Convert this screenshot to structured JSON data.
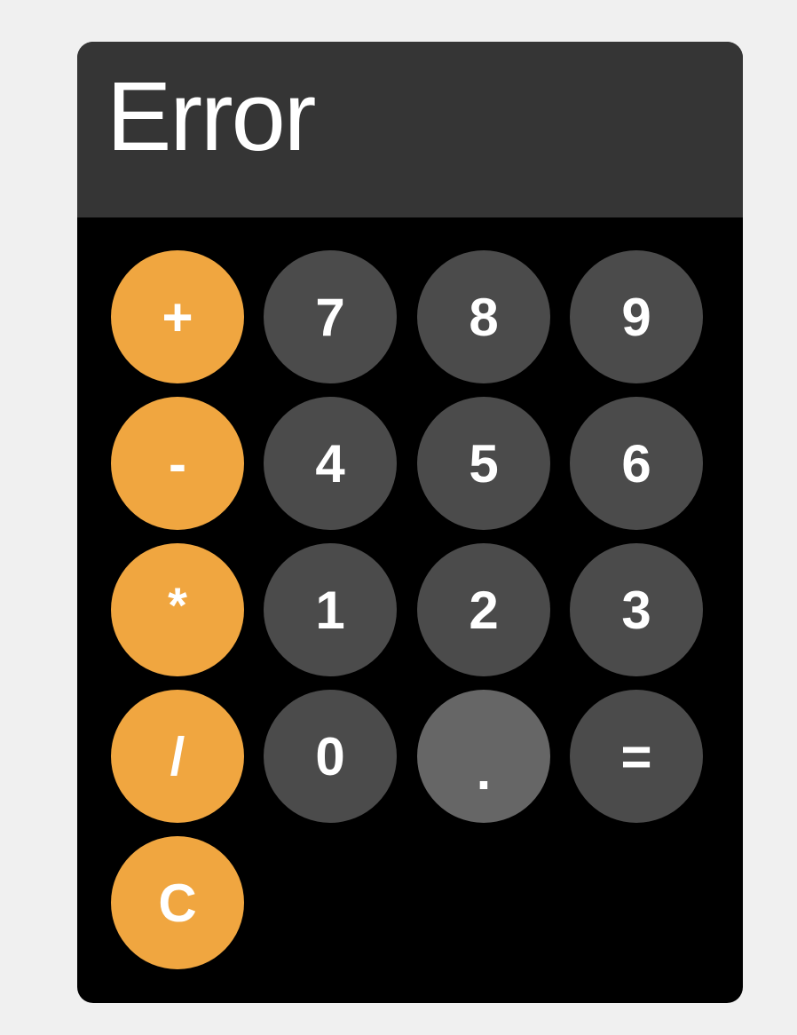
{
  "display": {
    "value": "Error"
  },
  "keys": {
    "plus": "+",
    "minus": "-",
    "multiply": "*",
    "divide": "/",
    "clear": "C",
    "seven": "7",
    "eight": "8",
    "nine": "9",
    "four": "4",
    "five": "5",
    "six": "6",
    "one": "1",
    "two": "2",
    "three": "3",
    "zero": "0",
    "decimal": ".",
    "equals": "="
  },
  "colors": {
    "operator": "#f0a640",
    "number": "#4b4b4b",
    "decimal": "#666666",
    "display_bg": "#353535",
    "body_bg": "#000000"
  }
}
